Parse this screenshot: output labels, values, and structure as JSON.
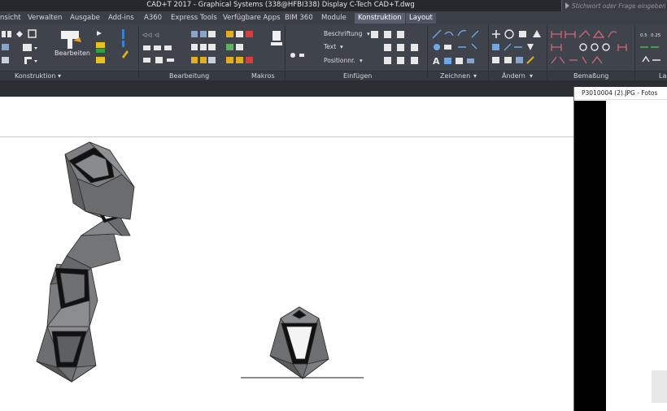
{
  "window": {
    "title": "CAD+T 2017 - Graphical Systems  (338@HFBI338)   Display C-Tech CAD+T.dwg",
    "search_placeholder": "Stichwort oder Frage eingeben"
  },
  "tabs": [
    {
      "label": "nsicht"
    },
    {
      "label": "Verwalten"
    },
    {
      "label": "Ausgabe"
    },
    {
      "label": "Add-ins"
    },
    {
      "label": "A360"
    },
    {
      "label": "Express Tools"
    },
    {
      "label": "Verfügbare Apps"
    },
    {
      "label": "BIM 360"
    },
    {
      "label": "Module"
    },
    {
      "label": "Konstruktion",
      "active": true
    },
    {
      "label": "Layout"
    }
  ],
  "ribbon": {
    "bearbeiten_button": "Bearbeiten",
    "beschriftung": "Beschriftung",
    "text": "Text",
    "positionnr": "Positionnr.",
    "groups": [
      {
        "label": "Konstruktion"
      },
      {
        "label": "Bearbeitung"
      },
      {
        "label": "Makros"
      },
      {
        "label": "Einfügen"
      },
      {
        "label": "Zeichnen"
      },
      {
        "label": "Ändern"
      },
      {
        "label": "Bemaßung"
      },
      {
        "label": "La"
      }
    ],
    "dim_labels": [
      "0.5",
      "0.25"
    ]
  },
  "photos": {
    "title": "P3010004 (2).JPG - Fotos"
  },
  "colors": {
    "accent_active_tab": "#5a6070",
    "ribbon_bg": "#3f434b",
    "title_bg": "#26282e"
  }
}
